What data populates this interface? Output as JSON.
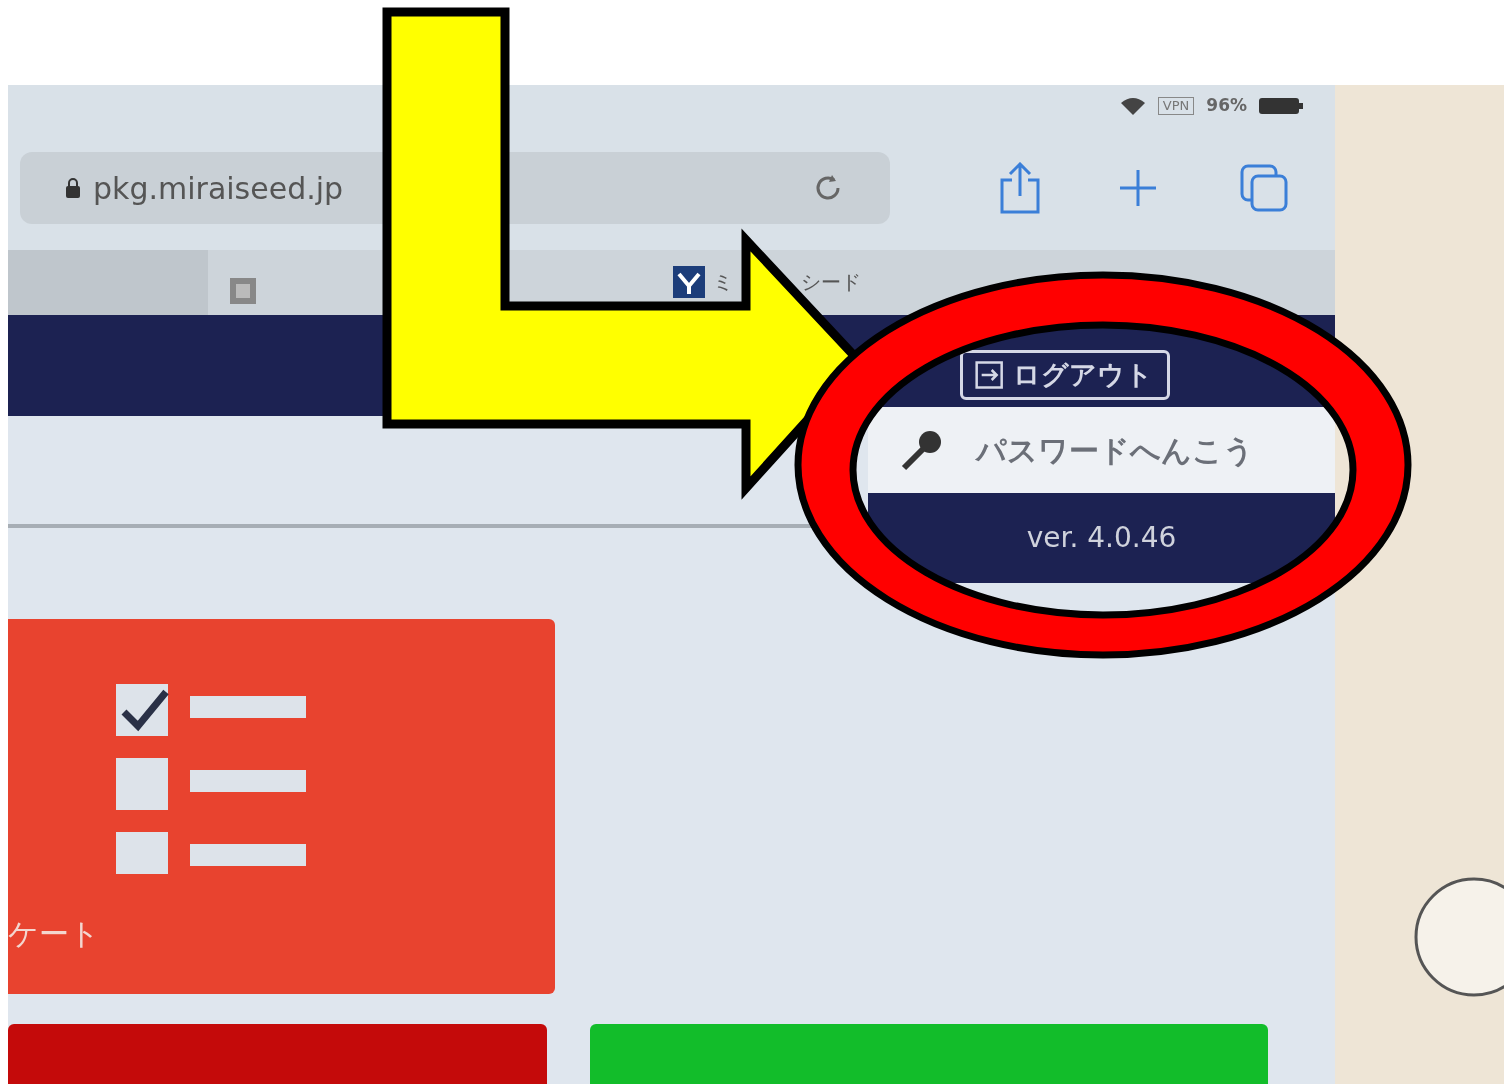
{
  "status_bar": {
    "carrier_box": "VPN",
    "battery": "96%"
  },
  "address_bar": {
    "url": "pkg.miraiseed.jp"
  },
  "tabs": [
    {
      "selected": true
    },
    {
      "title_parts": [
        "ミ",
        "シード"
      ],
      "selected": false
    }
  ],
  "header": {
    "logout_button": "ログアウト"
  },
  "menu": {
    "items": [
      {
        "label": "パスワードへんこう"
      }
    ],
    "version": "ver. 4.0.46"
  },
  "cards": [
    {
      "kind": "checklist",
      "label": "ケート",
      "color": "#e8432f"
    },
    {
      "kind": "plain",
      "color": "#c40a0a"
    },
    {
      "kind": "plain",
      "color": "#12bd2a"
    }
  ]
}
